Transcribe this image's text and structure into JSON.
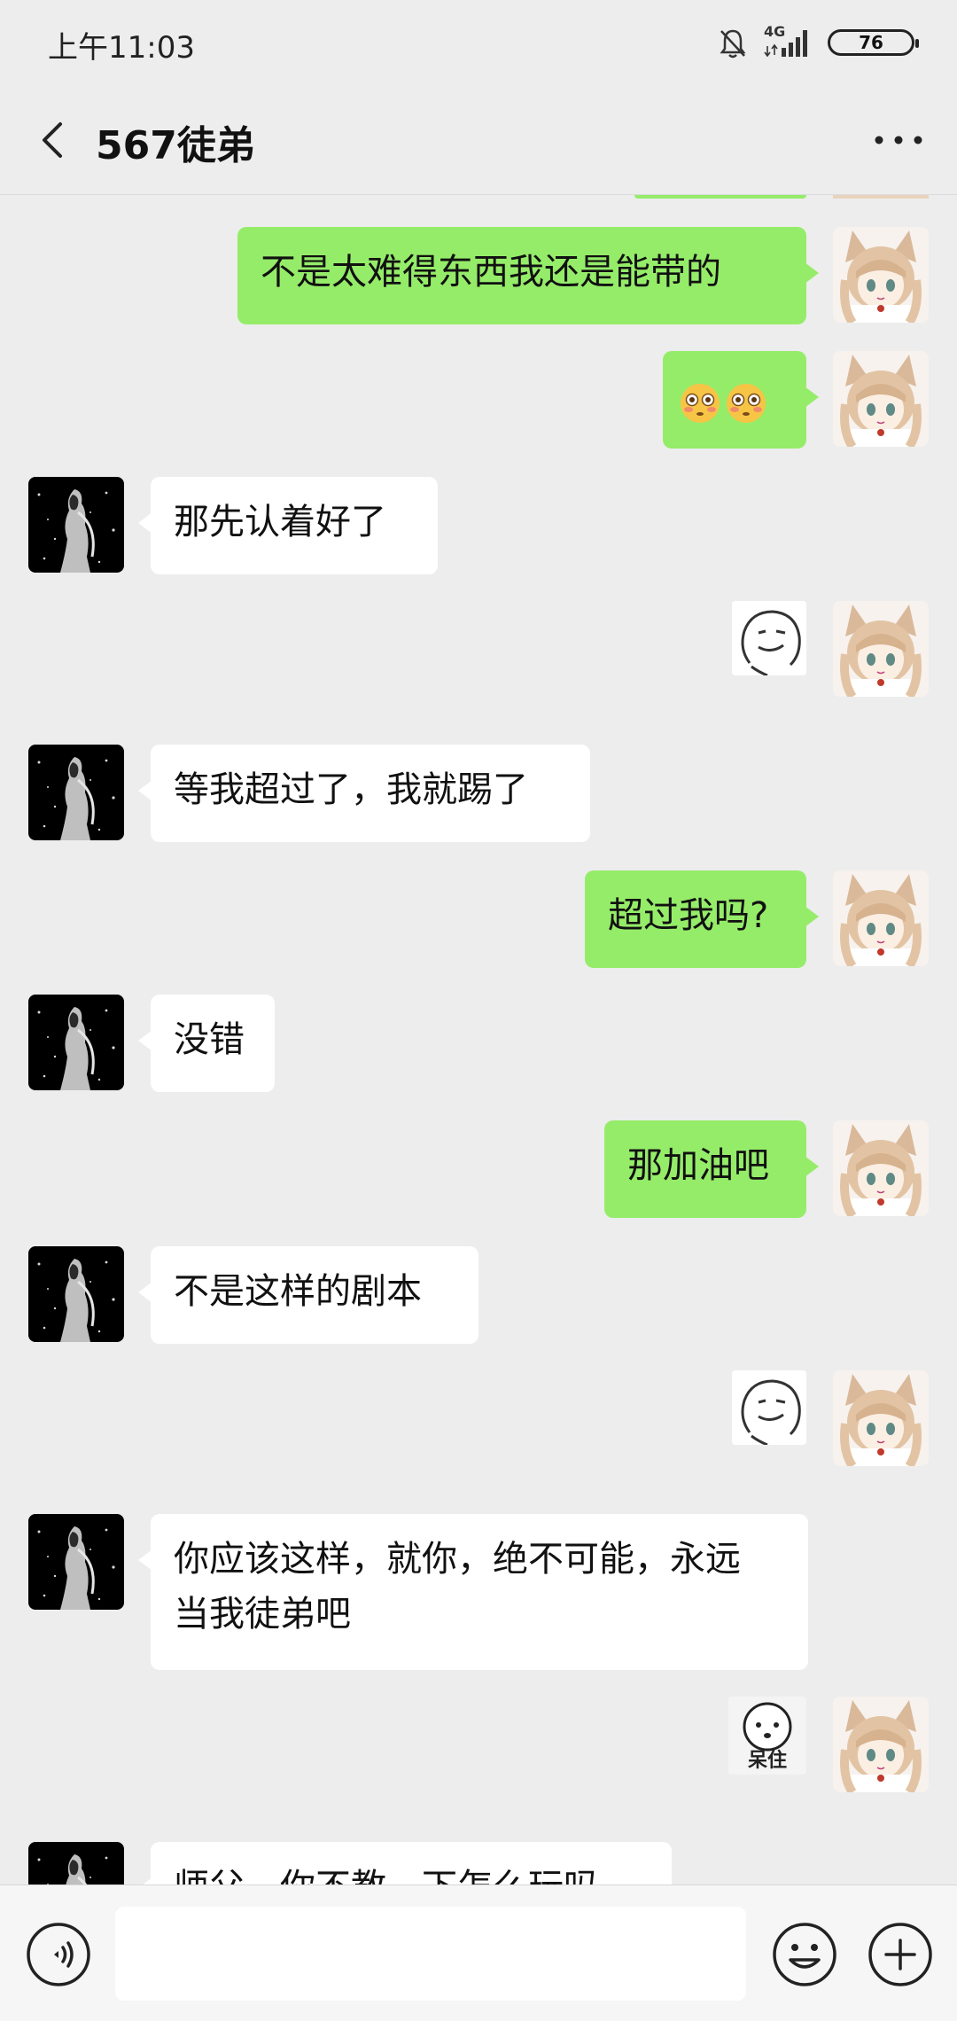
{
  "status_bar": {
    "time": "上午11:03",
    "network": "4G",
    "battery": "76"
  },
  "header": {
    "title": "567徒弟"
  },
  "messages": [
    {
      "dir": "out",
      "type": "text",
      "text": "不是太难得东西我还是能带的"
    },
    {
      "dir": "out",
      "type": "emoji",
      "emoji": "flushed-face x2"
    },
    {
      "dir": "in",
      "type": "text",
      "text": "那先认着好了"
    },
    {
      "dir": "out",
      "type": "sticker",
      "sticker": "smirk-face-sticker"
    },
    {
      "dir": "in",
      "type": "text",
      "text": "等我超过了，我就踢了"
    },
    {
      "dir": "out",
      "type": "text",
      "text": "超过我吗?"
    },
    {
      "dir": "in",
      "type": "text",
      "text": "没错"
    },
    {
      "dir": "out",
      "type": "text",
      "text": "那加油吧"
    },
    {
      "dir": "in",
      "type": "text",
      "text": "不是这样的剧本"
    },
    {
      "dir": "out",
      "type": "sticker",
      "sticker": "smirk-face-sticker"
    },
    {
      "dir": "in",
      "type": "text",
      "text_line1": "你应该这样，就你，绝不可能，永远",
      "text_line2": "当我徒弟吧"
    },
    {
      "dir": "out",
      "type": "sticker",
      "sticker": "dazed-face-sticker",
      "sticker_text": "呆住"
    },
    {
      "dir": "in",
      "type": "text",
      "text": "师父，你不教，下怎么玩吗"
    }
  ],
  "input_bar": {
    "placeholder": ""
  },
  "colors": {
    "out_bubble": "#95ec69",
    "in_bubble": "#ffffff",
    "background": "#ededed"
  },
  "icons": [
    "bell-off-icon",
    "signal-icon",
    "battery-icon",
    "back-chevron-icon",
    "more-icon",
    "voice-icon",
    "emoji-icon",
    "plus-icon"
  ]
}
